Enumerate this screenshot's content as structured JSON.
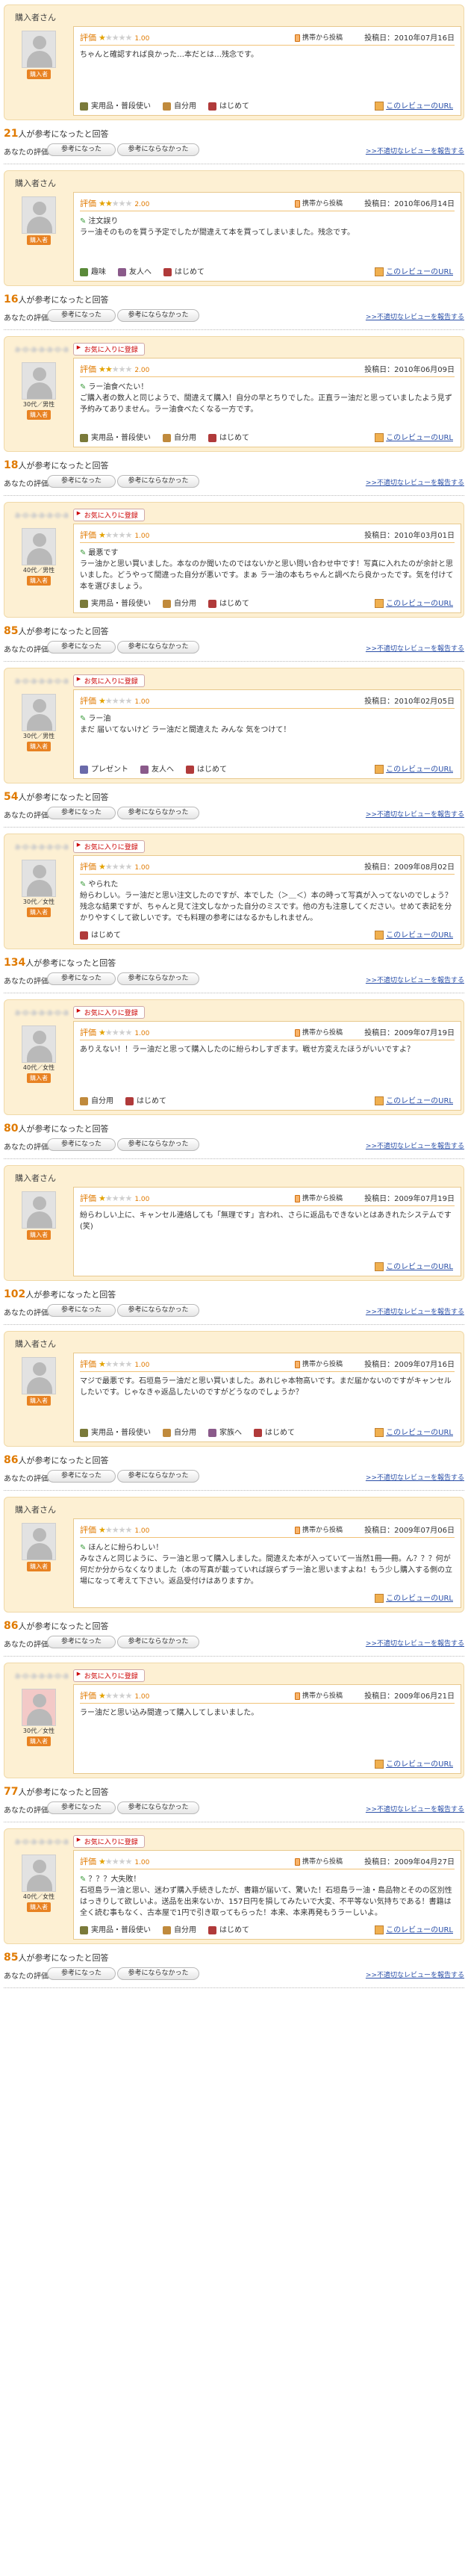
{
  "labels": {
    "rating": "評価",
    "helpful_suffix": "人が参考になったと回答",
    "your_rating": "あなたの評価⇒",
    "helpful_btn": "参考になった",
    "not_helpful_btn": "参考にならなかった",
    "report": ">>不適切なレビューを報告する",
    "permalink": "このレビューのURL",
    "posted_prefix": "投稿日：",
    "mobile": "携帯から投稿",
    "favorite": "お気に入りに登録",
    "buyer_tag": "購入者"
  },
  "colors": {
    "accent": "#e07a00",
    "card_bg": "#fdf0d3",
    "link": "#2a4fa8",
    "star": "#e3a200"
  },
  "reviews": [
    {
      "reviewer": "購入者さん",
      "reviewer_obscured": false,
      "favorite": false,
      "avatar": "buyer",
      "demographic": "",
      "stars": 1,
      "score": "1.00",
      "mobile": true,
      "date": "2010年07月16日",
      "title": "",
      "text": "ちゃんと確認すれば良かった…本だとは…残念です。",
      "usage": [
        {
          "icon": "c1",
          "label": "実用品・普段使い"
        },
        {
          "icon": "c2",
          "label": "自分用"
        },
        {
          "icon": "c5",
          "label": "はじめて"
        }
      ],
      "helpful": "21"
    },
    {
      "reviewer": "購入者さん",
      "reviewer_obscured": false,
      "favorite": false,
      "avatar": "buyer",
      "demographic": "",
      "stars": 2,
      "score": "2.00",
      "mobile": true,
      "date": "2010年06月14日",
      "title": "注文誤り",
      "text": "ラー油そのものを買う予定でしたが間違えて本を買ってしまいました。残念です。",
      "usage": [
        {
          "icon": "c4",
          "label": "趣味"
        },
        {
          "icon": "c3",
          "label": "友人へ"
        },
        {
          "icon": "c5",
          "label": "はじめて"
        }
      ],
      "helpful": "16"
    },
    {
      "reviewer": "a-o-a-a-a-o-a",
      "reviewer_obscured": true,
      "favorite": true,
      "avatar": "male",
      "demographic": "30代／男性\n購入者",
      "stars": 2,
      "score": "2.00",
      "mobile": false,
      "date": "2010年06月09日",
      "title": "ラー油食べたい！",
      "text": "ご購入者の数人と同じようで、間違えて購入！自分の早とちりでした。正直ラー油だと思っていましたよう見ず予約みてありません。ラー油食べたくなる一方です。",
      "usage": [
        {
          "icon": "c1",
          "label": "実用品・普段使い"
        },
        {
          "icon": "c2",
          "label": "自分用"
        },
        {
          "icon": "c5",
          "label": "はじめて"
        }
      ],
      "helpful": "18"
    },
    {
      "reviewer": "a-o-a-a-a-o-a",
      "reviewer_obscured": true,
      "favorite": true,
      "avatar": "male",
      "demographic": "40代／男性\n購入者",
      "stars": 1,
      "score": "1.00",
      "mobile": false,
      "date": "2010年03月01日",
      "title": "最悪です",
      "text": "ラー油かと思い買いました。本なのか聞いたのではないかと思い問い合わせ中です！写真に入れたのが余計と思いました。どうやって間違った自分が悪いです。まぁ ラー油の本もちゃんと調べたら良かったです。気を付けて本を選びましょう。",
      "usage": [
        {
          "icon": "c1",
          "label": "実用品・普段使い"
        },
        {
          "icon": "c2",
          "label": "自分用"
        },
        {
          "icon": "c5",
          "label": "はじめて"
        }
      ],
      "helpful": "85"
    },
    {
      "reviewer": "a-o-a-a-a-o-a",
      "reviewer_obscured": true,
      "favorite": true,
      "avatar": "male",
      "demographic": "30代／男性\n購入者",
      "stars": 1,
      "score": "1.00",
      "mobile": false,
      "date": "2010年02月05日",
      "title": "ラー油",
      "text": "まだ 届いてないけど ラー油だと間違えた みんな 気をつけて！",
      "usage": [
        {
          "icon": "c6",
          "label": "プレゼント"
        },
        {
          "icon": "c3",
          "label": "友人へ"
        },
        {
          "icon": "c5",
          "label": "はじめて"
        }
      ],
      "helpful": "54"
    },
    {
      "reviewer": "a-o-a-a-a-o-a",
      "reviewer_obscured": true,
      "favorite": true,
      "avatar": "female",
      "demographic": "30代／女性\n購入者",
      "stars": 1,
      "score": "1.00",
      "mobile": false,
      "date": "2009年08月02日",
      "title": "やられた",
      "text": "紛らわしい。ラー油だと思い注文したのですが、本でした（＞＿＜）本の時って写真が入ってないのでしょう？残念な結果ですが、ちゃんと見て注文しなかった自分のミスです。他の方も注意してください。せめて表記を分かりやすくして欲しいです。でも料理の参考にはなるかもしれません。",
      "usage": [
        {
          "icon": "c5",
          "label": "はじめて"
        }
      ],
      "helpful": "134"
    },
    {
      "reviewer": "a-o-a-a-a-o-a",
      "reviewer_obscured": true,
      "favorite": true,
      "avatar": "female",
      "demographic": "40代／女性\n購入者",
      "stars": 1,
      "score": "1.00",
      "mobile": true,
      "date": "2009年07月19日",
      "title": "",
      "text": "ありえない！！ラー油だと思って購入したのに紛らわしすぎます。戦せ方変えたほうがいいですよ？",
      "usage": [
        {
          "icon": "c2",
          "label": "自分用"
        },
        {
          "icon": "c5",
          "label": "はじめて"
        }
      ],
      "helpful": "80"
    },
    {
      "reviewer": "購入者さん",
      "reviewer_obscured": false,
      "favorite": false,
      "avatar": "buyer",
      "demographic": "",
      "stars": 1,
      "score": "1.00",
      "mobile": true,
      "date": "2009年07月19日",
      "title": "",
      "text": "紛らわしい上に、キャンセル連絡しても「無理です」言われ、さらに返品もできないとはあきれたシステムです(笑)",
      "usage": [],
      "helpful": "102"
    },
    {
      "reviewer": "購入者さん",
      "reviewer_obscured": false,
      "favorite": false,
      "avatar": "buyer",
      "demographic": "",
      "stars": 1,
      "score": "1.00",
      "mobile": true,
      "date": "2009年07月16日",
      "title": "",
      "text": "マジで最悪です。石垣島ラー油だと思い買いました。あれじゃ本物高いです。まだ届かないのですがキャンセルしたいです。じゃなきゃ返品したいのですがどうなのでしょうか？",
      "usage": [
        {
          "icon": "c1",
          "label": "実用品・普段使い"
        },
        {
          "icon": "c2",
          "label": "自分用"
        },
        {
          "icon": "c3",
          "label": "家族へ"
        },
        {
          "icon": "c5",
          "label": "はじめて"
        }
      ],
      "helpful": "86"
    },
    {
      "reviewer": "購入者さん",
      "reviewer_obscured": false,
      "favorite": false,
      "avatar": "buyer",
      "demographic": "",
      "stars": 1,
      "score": "1.00",
      "mobile": true,
      "date": "2009年07月06日",
      "title": "ほんとに紛らわしい！",
      "text": "みなさんと同じように、ラー油と思って購入しました。間違えた本が入っていて一当然1冊──冊。ん？？？何が何だか分からなくなりました（本の写真が載っていれば誤らずラー油と思いますよね！もう少し購入する側の立場になって考えて下さい。返品受付けはありますか。",
      "usage": [],
      "helpful": "86"
    },
    {
      "reviewer": "a-o-a-a-a-o-a",
      "reviewer_obscured": true,
      "favorite": true,
      "avatar": "female-pink",
      "demographic": "30代／女性\n購入者",
      "stars": 1,
      "score": "1.00",
      "mobile": true,
      "date": "2009年06月21日",
      "title": "",
      "text": "ラー油だと思い込み間違って購入してしまいました。",
      "usage": [],
      "helpful": "77"
    },
    {
      "reviewer": "a-o-a-a-a-o-a",
      "reviewer_obscured": true,
      "favorite": true,
      "avatar": "female",
      "demographic": "40代／女性\n購入者",
      "stars": 1,
      "score": "1.00",
      "mobile": true,
      "date": "2009年04月27日",
      "title": "？？？大失敗！",
      "text": "石垣島ラー油と思い、迷わず購入手続きしたが、書籍が届いて、驚いた！石垣島ラー油・島品物とそのの区別性はっきりして欲しいよ。送品を出来ないか、157日円を損してみたいで大変、不平等ない気持ちである！書籍は全く読む事もなく、古本屋で1円で引き取ってもらった！本来、本来再発もうラーしいよ。",
      "usage": [
        {
          "icon": "c1",
          "label": "実用品・普段使い"
        },
        {
          "icon": "c2",
          "label": "自分用"
        },
        {
          "icon": "c5",
          "label": "はじめて"
        }
      ],
      "helpful": "85"
    }
  ]
}
